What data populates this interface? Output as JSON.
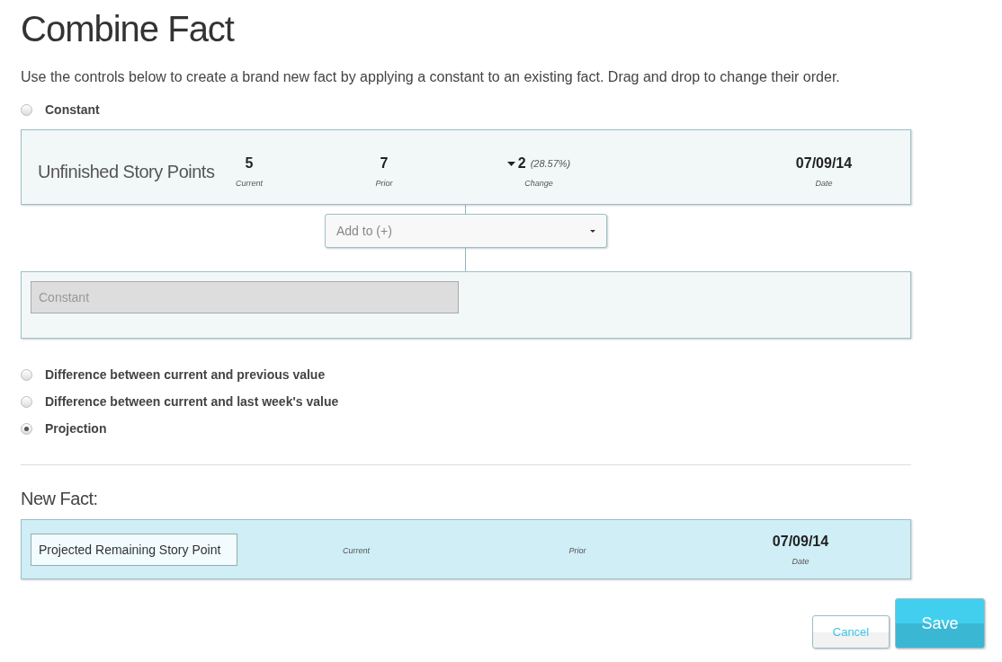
{
  "title": "Combine Fact",
  "description": "Use the controls below to create a brand new fact by applying a constant to an existing fact. Drag and drop to change their order.",
  "options": [
    {
      "label": "Constant",
      "selected": false
    },
    {
      "label": "Difference between current and previous value",
      "selected": false
    },
    {
      "label": "Difference between current and last week's value",
      "selected": false
    },
    {
      "label": "Projection",
      "selected": true
    }
  ],
  "source_fact": {
    "name": "Unfinished Story Points",
    "current": "5",
    "current_label": "Current",
    "prior": "7",
    "prior_label": "Prior",
    "change": "2",
    "change_percent": "(28.57%)",
    "change_label": "Change",
    "date": "07/09/14",
    "date_label": "Date"
  },
  "operator": {
    "value": "Add to (+)"
  },
  "constant_field": {
    "placeholder": "Constant"
  },
  "new_fact": {
    "heading": "New Fact:",
    "name": "Projected Remaining Story Point",
    "current_label": "Current",
    "prior_label": "Prior",
    "date": "07/09/14",
    "date_label": "Date"
  },
  "buttons": {
    "cancel": "Cancel",
    "save": "Save"
  }
}
